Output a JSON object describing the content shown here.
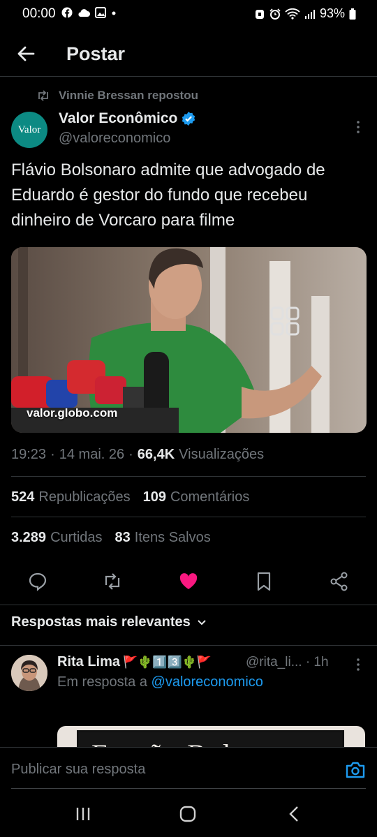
{
  "status_bar": {
    "time": "00:00",
    "battery": "93%",
    "left_icons": [
      "facebook-icon",
      "cloud-icon",
      "gallery-icon",
      "dot-icon"
    ],
    "right_icons": [
      "lock-icon",
      "alarm-icon",
      "wifi-icon",
      "signal-icon",
      "battery-icon"
    ]
  },
  "header": {
    "title": "Postar"
  },
  "post": {
    "repost_label": "Vinnie Bressan repostou",
    "author_name": "Valor Econômico",
    "author_handle": "@valoreconomico",
    "avatar_text": "Valor",
    "text": "Flávio Bolsonaro admite que advogado de Eduardo é gestor do fundo que recebeu dinheiro de Vorcaro para filme",
    "media_source": "valor.globo.com",
    "time": "19:23",
    "date": "14 mai. 26",
    "views_count": "66,4K",
    "views_label": "Visualizações",
    "reposts_count": "524",
    "reposts_label": "Republicações",
    "comments_count": "109",
    "comments_label": "Comentários",
    "likes_count": "3.289",
    "likes_label": "Curtidas",
    "saves_count": "83",
    "saves_label": "Itens Salvos"
  },
  "replies": {
    "sort_label": "Respostas mais relevantes",
    "items": [
      {
        "name": "Rita Lima",
        "emojis": "🚩🌵1️⃣3️⃣🌵🚩",
        "handle": "@rita_li...",
        "time": "· 1h",
        "reply_to_prefix": "Em resposta a",
        "reply_to_handle": "@valoreconomico",
        "media_text": "Facção Bolsonaro"
      }
    ]
  },
  "composer": {
    "placeholder": "Publicar sua resposta"
  },
  "colors": {
    "background": "#000000",
    "text": "#e7e9ea",
    "muted": "#71767b",
    "accent": "#1d9bf0",
    "like": "#f91880",
    "divider": "#2f3336"
  }
}
